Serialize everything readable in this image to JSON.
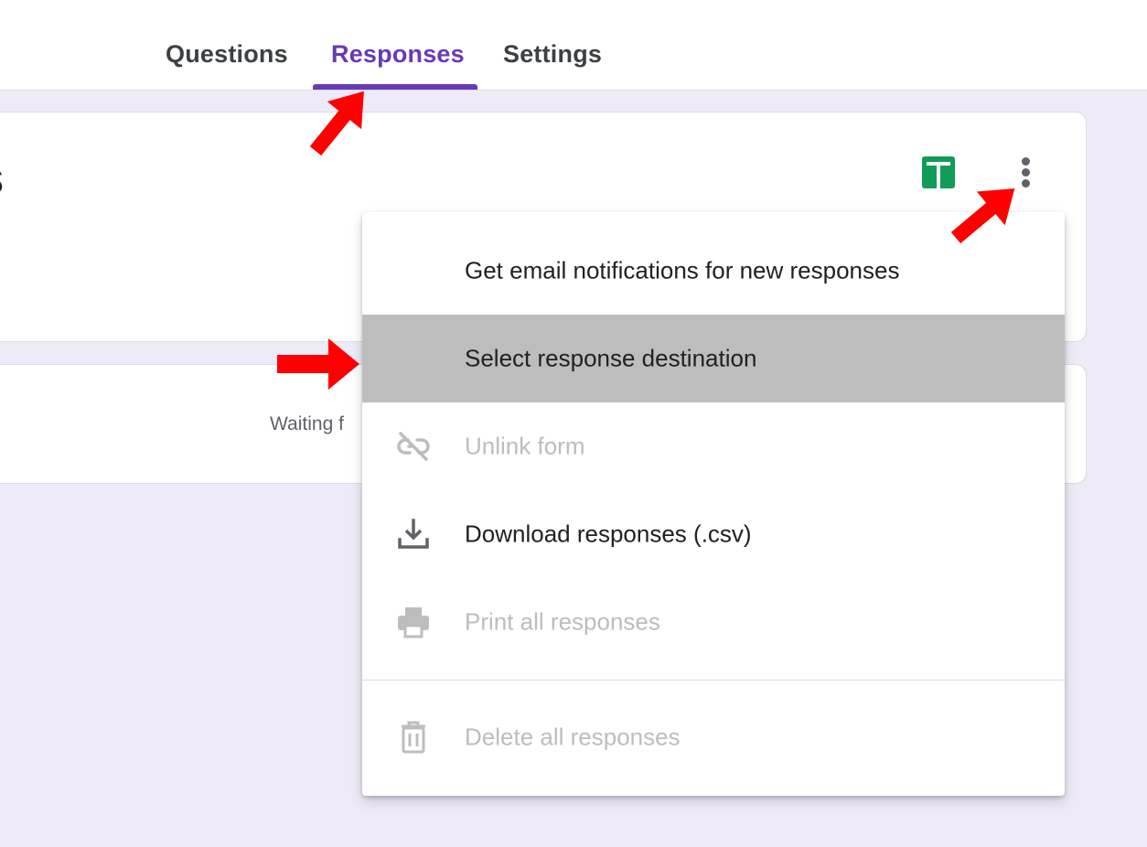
{
  "tabs": [
    {
      "label": "Questions",
      "active": false
    },
    {
      "label": "Responses",
      "active": true
    },
    {
      "label": "Settings",
      "active": false
    }
  ],
  "summary": {
    "title_fragment": "s",
    "status_text": "Waiting f"
  },
  "actions": {
    "sheets_icon": "google-sheets-icon",
    "more_icon": "more-vert-icon"
  },
  "menu": {
    "items": [
      {
        "label": "Get email notifications for new responses",
        "icon": "",
        "disabled": false,
        "highlighted": false
      },
      {
        "label": "Select response destination",
        "icon": "",
        "disabled": false,
        "highlighted": true
      },
      {
        "label": "Unlink form",
        "icon": "link-off-icon",
        "disabled": true,
        "highlighted": false
      },
      {
        "label": "Download responses (.csv)",
        "icon": "download-icon",
        "disabled": false,
        "highlighted": false
      },
      {
        "label": "Print all responses",
        "icon": "print-icon",
        "disabled": true,
        "highlighted": false
      },
      {
        "label": "Delete all responses",
        "icon": "delete-icon",
        "disabled": true,
        "highlighted": false
      }
    ]
  },
  "colors": {
    "accent": "#673ab7",
    "page_background": "#efeaf8",
    "sheets_green": "#0f9d58",
    "highlight": "#bdbdbd",
    "annotation_arrow": "#ff0000"
  }
}
